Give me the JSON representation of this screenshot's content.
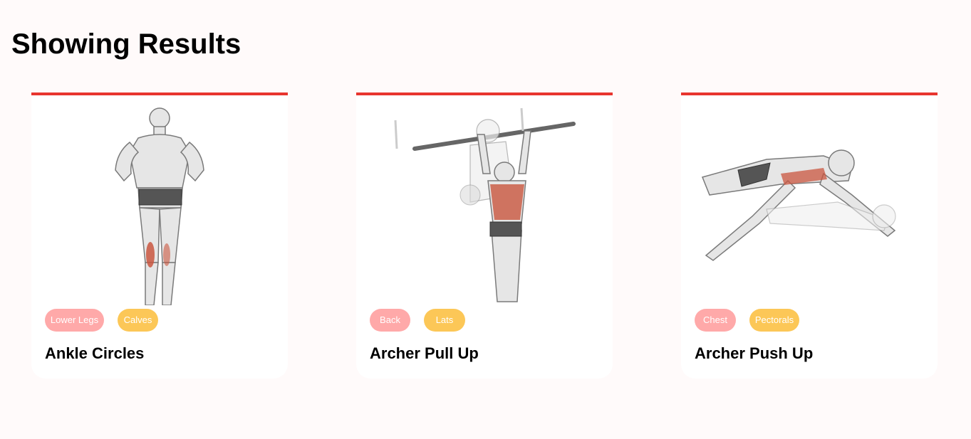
{
  "page": {
    "title": "Showing Results"
  },
  "accent_color": "#e8352f",
  "body_part_pill_color": "#ffa9a9",
  "target_pill_color": "#fcc757",
  "exercises": [
    {
      "body_part": "Lower Legs",
      "target": "Calves",
      "name": "Ankle Circles",
      "illustration": "ankle-circles-illustration"
    },
    {
      "body_part": "Back",
      "target": "Lats",
      "name": "Archer Pull Up",
      "illustration": "archer-pull-up-illustration"
    },
    {
      "body_part": "Chest",
      "target": "Pectorals",
      "name": "Archer Push Up",
      "illustration": "archer-push-up-illustration"
    }
  ]
}
